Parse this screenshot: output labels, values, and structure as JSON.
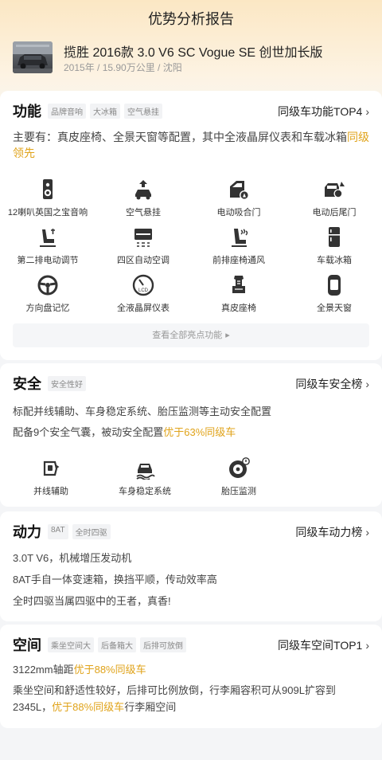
{
  "header": {
    "title": "优势分析报告"
  },
  "car": {
    "name": "揽胜 2016款 3.0 V6 SC Vogue SE 创世加长版",
    "meta": "2015年 / 15.90万公里 / 沈阳"
  },
  "function_section": {
    "title": "功能",
    "tags": [
      "品牌音响",
      "大冰箱",
      "空气悬挂"
    ],
    "rank_label": "同级车功能TOP4",
    "summary_prefix": "主要有：真皮座椅、全景天窗等配置，其中全液晶屏仪表和车载冰箱",
    "summary_highlight": "同级领先",
    "features": [
      {
        "label": "12喇叭英国之宝音响",
        "icon": "speaker-icon"
      },
      {
        "label": "空气悬挂",
        "icon": "air-suspension-icon"
      },
      {
        "label": "电动吸合门",
        "icon": "soft-close-door-icon"
      },
      {
        "label": "电动后尾门",
        "icon": "power-tailgate-icon"
      },
      {
        "label": "第二排电动调节",
        "icon": "power-seat-icon"
      },
      {
        "label": "四区自动空调",
        "icon": "climate-control-icon"
      },
      {
        "label": "前排座椅通风",
        "icon": "seat-ventilation-icon"
      },
      {
        "label": "车载冰箱",
        "icon": "fridge-icon"
      },
      {
        "label": "方向盘记忆",
        "icon": "steering-wheel-icon"
      },
      {
        "label": "全液晶屏仪表",
        "icon": "lcd-gauge-icon"
      },
      {
        "label": "真皮座椅",
        "icon": "leather-seat-icon"
      },
      {
        "label": "全景天窗",
        "icon": "panoramic-roof-icon"
      }
    ],
    "see_all": "查看全部亮点功能"
  },
  "safety_section": {
    "title": "安全",
    "tags": [
      "安全性好"
    ],
    "rank_label": "同级车安全榜",
    "line1": "标配并线辅助、车身稳定系统、胎压监测等主动安全配置",
    "line2_prefix": "配备9个安全气囊，被动安全配置",
    "line2_highlight": "优于63%同级车",
    "features": [
      {
        "label": "并线辅助",
        "icon": "lane-assist-icon"
      },
      {
        "label": "车身稳定系统",
        "icon": "stability-control-icon"
      },
      {
        "label": "胎压监测",
        "icon": "tire-pressure-icon"
      }
    ]
  },
  "power_section": {
    "title": "动力",
    "tags": [
      "8AT",
      "全时四驱"
    ],
    "rank_label": "同级车动力榜",
    "lines": [
      "3.0T V6，机械增压发动机",
      "8AT手自一体变速箱，换挡平顺，传动效率高",
      "全时四驱当属四驱中的王者，真香!"
    ]
  },
  "space_section": {
    "title": "空间",
    "tags": [
      "乘坐空间大",
      "后备箱大",
      "后排可放倒"
    ],
    "rank_label": "同级车空间TOP1",
    "line1_prefix": "3122mm轴距",
    "line1_highlight": "优于88%同级车",
    "line2": "乘坐空间和舒适性较好，后排可比例放倒，行李厢容积可从909L扩容到",
    "line3_prefix": "2345L，",
    "line3_highlight": "优于88%同级车",
    "line3_suffix": "行李厢空间"
  },
  "colors": {
    "accent": "#e0a31a",
    "text": "#222222",
    "muted": "#999999"
  }
}
